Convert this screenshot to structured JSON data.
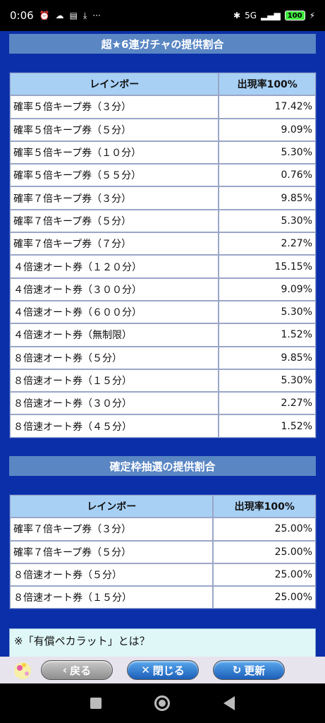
{
  "status_bar": {
    "time": "0:06",
    "network": "5G",
    "battery": "100"
  },
  "section1": {
    "title": "超★6連ガチャの提供割合",
    "header_name": "レインボー",
    "header_rate": "出現率100%",
    "rows": [
      {
        "name": "確率５倍キープ券（３分）",
        "rate": "17.42%"
      },
      {
        "name": "確率５倍キープ券（５分）",
        "rate": "9.09%"
      },
      {
        "name": "確率５倍キープ券（１０分）",
        "rate": "5.30%"
      },
      {
        "name": "確率５倍キープ券（５５分）",
        "rate": "0.76%"
      },
      {
        "name": "確率７倍キープ券（３分）",
        "rate": "9.85%"
      },
      {
        "name": "確率７倍キープ券（５分）",
        "rate": "5.30%"
      },
      {
        "name": "確率７倍キープ券（７分）",
        "rate": "2.27%"
      },
      {
        "name": "４倍速オート券（１２０分）",
        "rate": "15.15%"
      },
      {
        "name": "４倍速オート券（３００分）",
        "rate": "9.09%"
      },
      {
        "name": "４倍速オート券（６００分）",
        "rate": "5.30%"
      },
      {
        "name": "４倍速オート券（無制限）",
        "rate": "1.52%"
      },
      {
        "name": "８倍速オート券（５分）",
        "rate": "9.85%"
      },
      {
        "name": "８倍速オート券（１５分）",
        "rate": "5.30%"
      },
      {
        "name": "８倍速オート券（３０分）",
        "rate": "2.27%"
      },
      {
        "name": "８倍速オート券（４５分）",
        "rate": "1.52%"
      }
    ]
  },
  "section2": {
    "title": "確定枠抽選の提供割合",
    "header_name": "レインボー",
    "header_rate": "出現率100%",
    "rows": [
      {
        "name": "確率７倍キープ券（３分）",
        "rate": "25.00%"
      },
      {
        "name": "確率７倍キープ券（５分）",
        "rate": "25.00%"
      },
      {
        "name": "８倍速オート券（５分）",
        "rate": "25.00%"
      },
      {
        "name": "８倍速オート券（１５分）",
        "rate": "25.00%"
      }
    ]
  },
  "note": {
    "text": "※「有償ペカラット」とは？"
  },
  "toolbar": {
    "back_label": "戻る",
    "close_label": "閉じる",
    "update_label": "更新"
  },
  "colors": {
    "background": "#0b2fa8",
    "section_title": "#5a86c3",
    "table_header": "#a8d0f5",
    "note_bg": "#dff7f7"
  }
}
